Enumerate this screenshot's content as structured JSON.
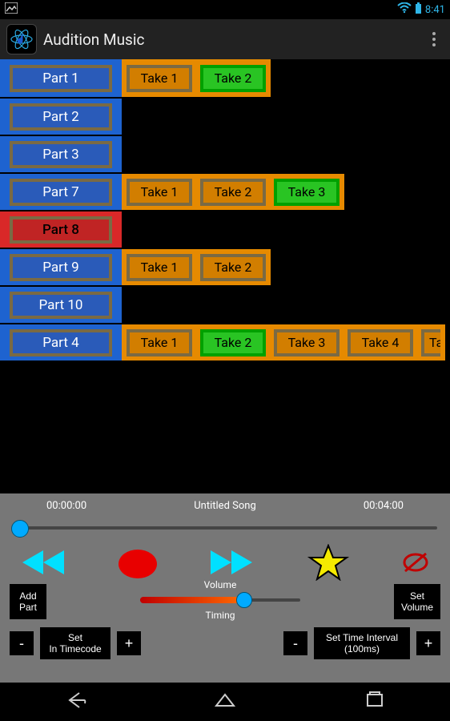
{
  "status": {
    "time": "8:41"
  },
  "header": {
    "title": "Audition Music"
  },
  "rows": [
    {
      "part": "Part 1",
      "style": "blue",
      "takes": [
        {
          "label": "Take 1",
          "sel": false
        },
        {
          "label": "Take 2",
          "sel": true
        }
      ]
    },
    {
      "part": "Part 2",
      "style": "blue",
      "takes": []
    },
    {
      "part": "Part 3",
      "style": "blue",
      "takes": []
    },
    {
      "part": "Part 7",
      "style": "blue",
      "takes": [
        {
          "label": "Take 1",
          "sel": false
        },
        {
          "label": "Take 2",
          "sel": false
        },
        {
          "label": "Take 3",
          "sel": true
        }
      ]
    },
    {
      "part": "Part 8",
      "style": "red",
      "takes": []
    },
    {
      "part": "Part 9",
      "style": "blue",
      "takes": [
        {
          "label": "Take 1",
          "sel": false
        },
        {
          "label": "Take 2",
          "sel": false
        }
      ]
    },
    {
      "part": "Part 10",
      "style": "blue",
      "takes": []
    },
    {
      "part": "Part 4",
      "style": "blue",
      "takes": [
        {
          "label": "Take 1",
          "sel": false
        },
        {
          "label": "Take 2",
          "sel": true
        },
        {
          "label": "Take 3",
          "sel": false
        },
        {
          "label": "Take 4",
          "sel": false
        },
        {
          "label": "Ta",
          "sel": false,
          "half": true
        }
      ]
    }
  ],
  "panel": {
    "time_start": "00:00:00",
    "song_title": "Untitled Song",
    "time_end": "00:04:00",
    "add_part_label": "Add\nPart",
    "set_volume_label": "Set\nVolume",
    "volume_label": "Volume",
    "timing_label": "Timing",
    "minus": "-",
    "plus": "+",
    "set_in_tc": "Set\nIn Timecode",
    "set_interval": "Set Time Interval\n(100ms)"
  }
}
